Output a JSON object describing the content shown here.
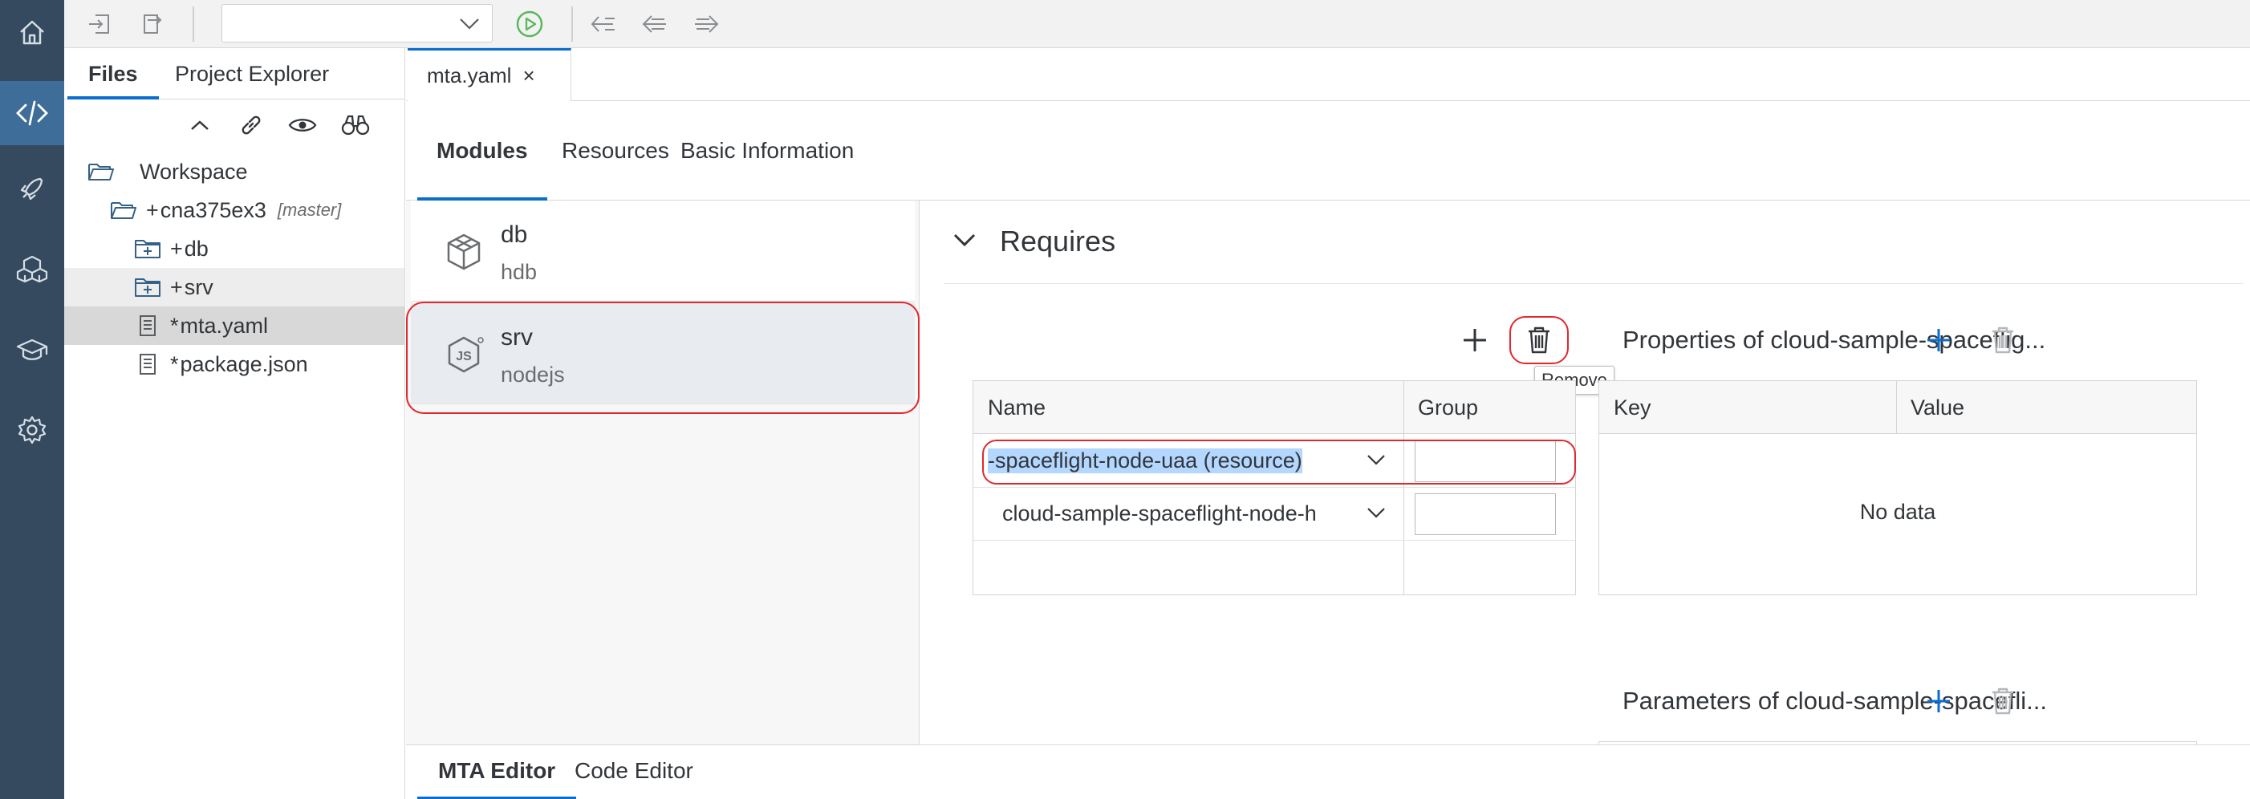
{
  "activity_bar": {
    "items": [
      {
        "icon": "home-icon"
      },
      {
        "icon": "code-icon",
        "active": true
      },
      {
        "icon": "rocket-icon"
      },
      {
        "icon": "cubes-icon"
      },
      {
        "icon": "learning-icon"
      },
      {
        "icon": "gear-icon"
      }
    ]
  },
  "toolbar": {
    "run_config_value": "",
    "icons": [
      "import-icon",
      "export-icon",
      "run-icon",
      "step-back-icon",
      "back-icon",
      "forward-icon"
    ]
  },
  "files_panel": {
    "tabs": [
      "Files",
      "Project Explorer"
    ],
    "active_tab": "Files",
    "tools": [
      "collapse-icon",
      "link-icon",
      "eye-icon",
      "binoculars-icon"
    ],
    "tree": [
      {
        "label": "Workspace",
        "prefix": "",
        "icon": "folder-open-icon",
        "indent": 0
      },
      {
        "label": "cna375ex3",
        "prefix": "+",
        "branch": "[master]",
        "icon": "folder-open-icon",
        "indent": 1
      },
      {
        "label": "db",
        "prefix": "+",
        "icon": "folder-plus-icon",
        "indent": 2
      },
      {
        "label": "srv",
        "prefix": "+",
        "icon": "folder-plus-icon",
        "indent": 2,
        "state": "hover"
      },
      {
        "label": "mta.yaml",
        "prefix": "*",
        "icon": "document-icon",
        "indent": 2,
        "state": "selected"
      },
      {
        "label": "package.json",
        "prefix": "*",
        "icon": "document-icon",
        "indent": 2
      }
    ]
  },
  "editor": {
    "file_tab": "mta.yaml",
    "file_tab_close": "×",
    "mta_tabs": [
      "Modules",
      "Resources",
      "Basic Information"
    ],
    "active_mta_tab": "Modules",
    "modules": [
      {
        "name": "db",
        "type": "hdb",
        "icon": "hdb-module-icon"
      },
      {
        "name": "srv",
        "type": "nodejs",
        "icon": "nodejs-module-icon",
        "selected": true
      }
    ],
    "requires": {
      "title": "Requires",
      "columns": [
        "Name",
        "Group"
      ],
      "rows": [
        {
          "name": "-spaceflight-node-uaa (resource)",
          "group": "",
          "selected": true
        },
        {
          "name": "cloud-sample-spaceflight-node-h",
          "group": ""
        }
      ],
      "remove_tooltip": "Remove"
    },
    "properties": {
      "title": "Properties of cloud-sample-spaceflig...",
      "columns": [
        "Key",
        "Value"
      ],
      "empty_text": "No data"
    },
    "parameters": {
      "title": "Parameters of cloud-sample-spacefli..."
    },
    "bottom_tabs": [
      "MTA Editor",
      "Code Editor"
    ],
    "active_bottom_tab": "MTA Editor"
  },
  "colors": {
    "activity_bg": "#354a5f",
    "activity_active": "#3f6d99",
    "accent": "#0a6ed1",
    "highlight": "#e0282e"
  }
}
